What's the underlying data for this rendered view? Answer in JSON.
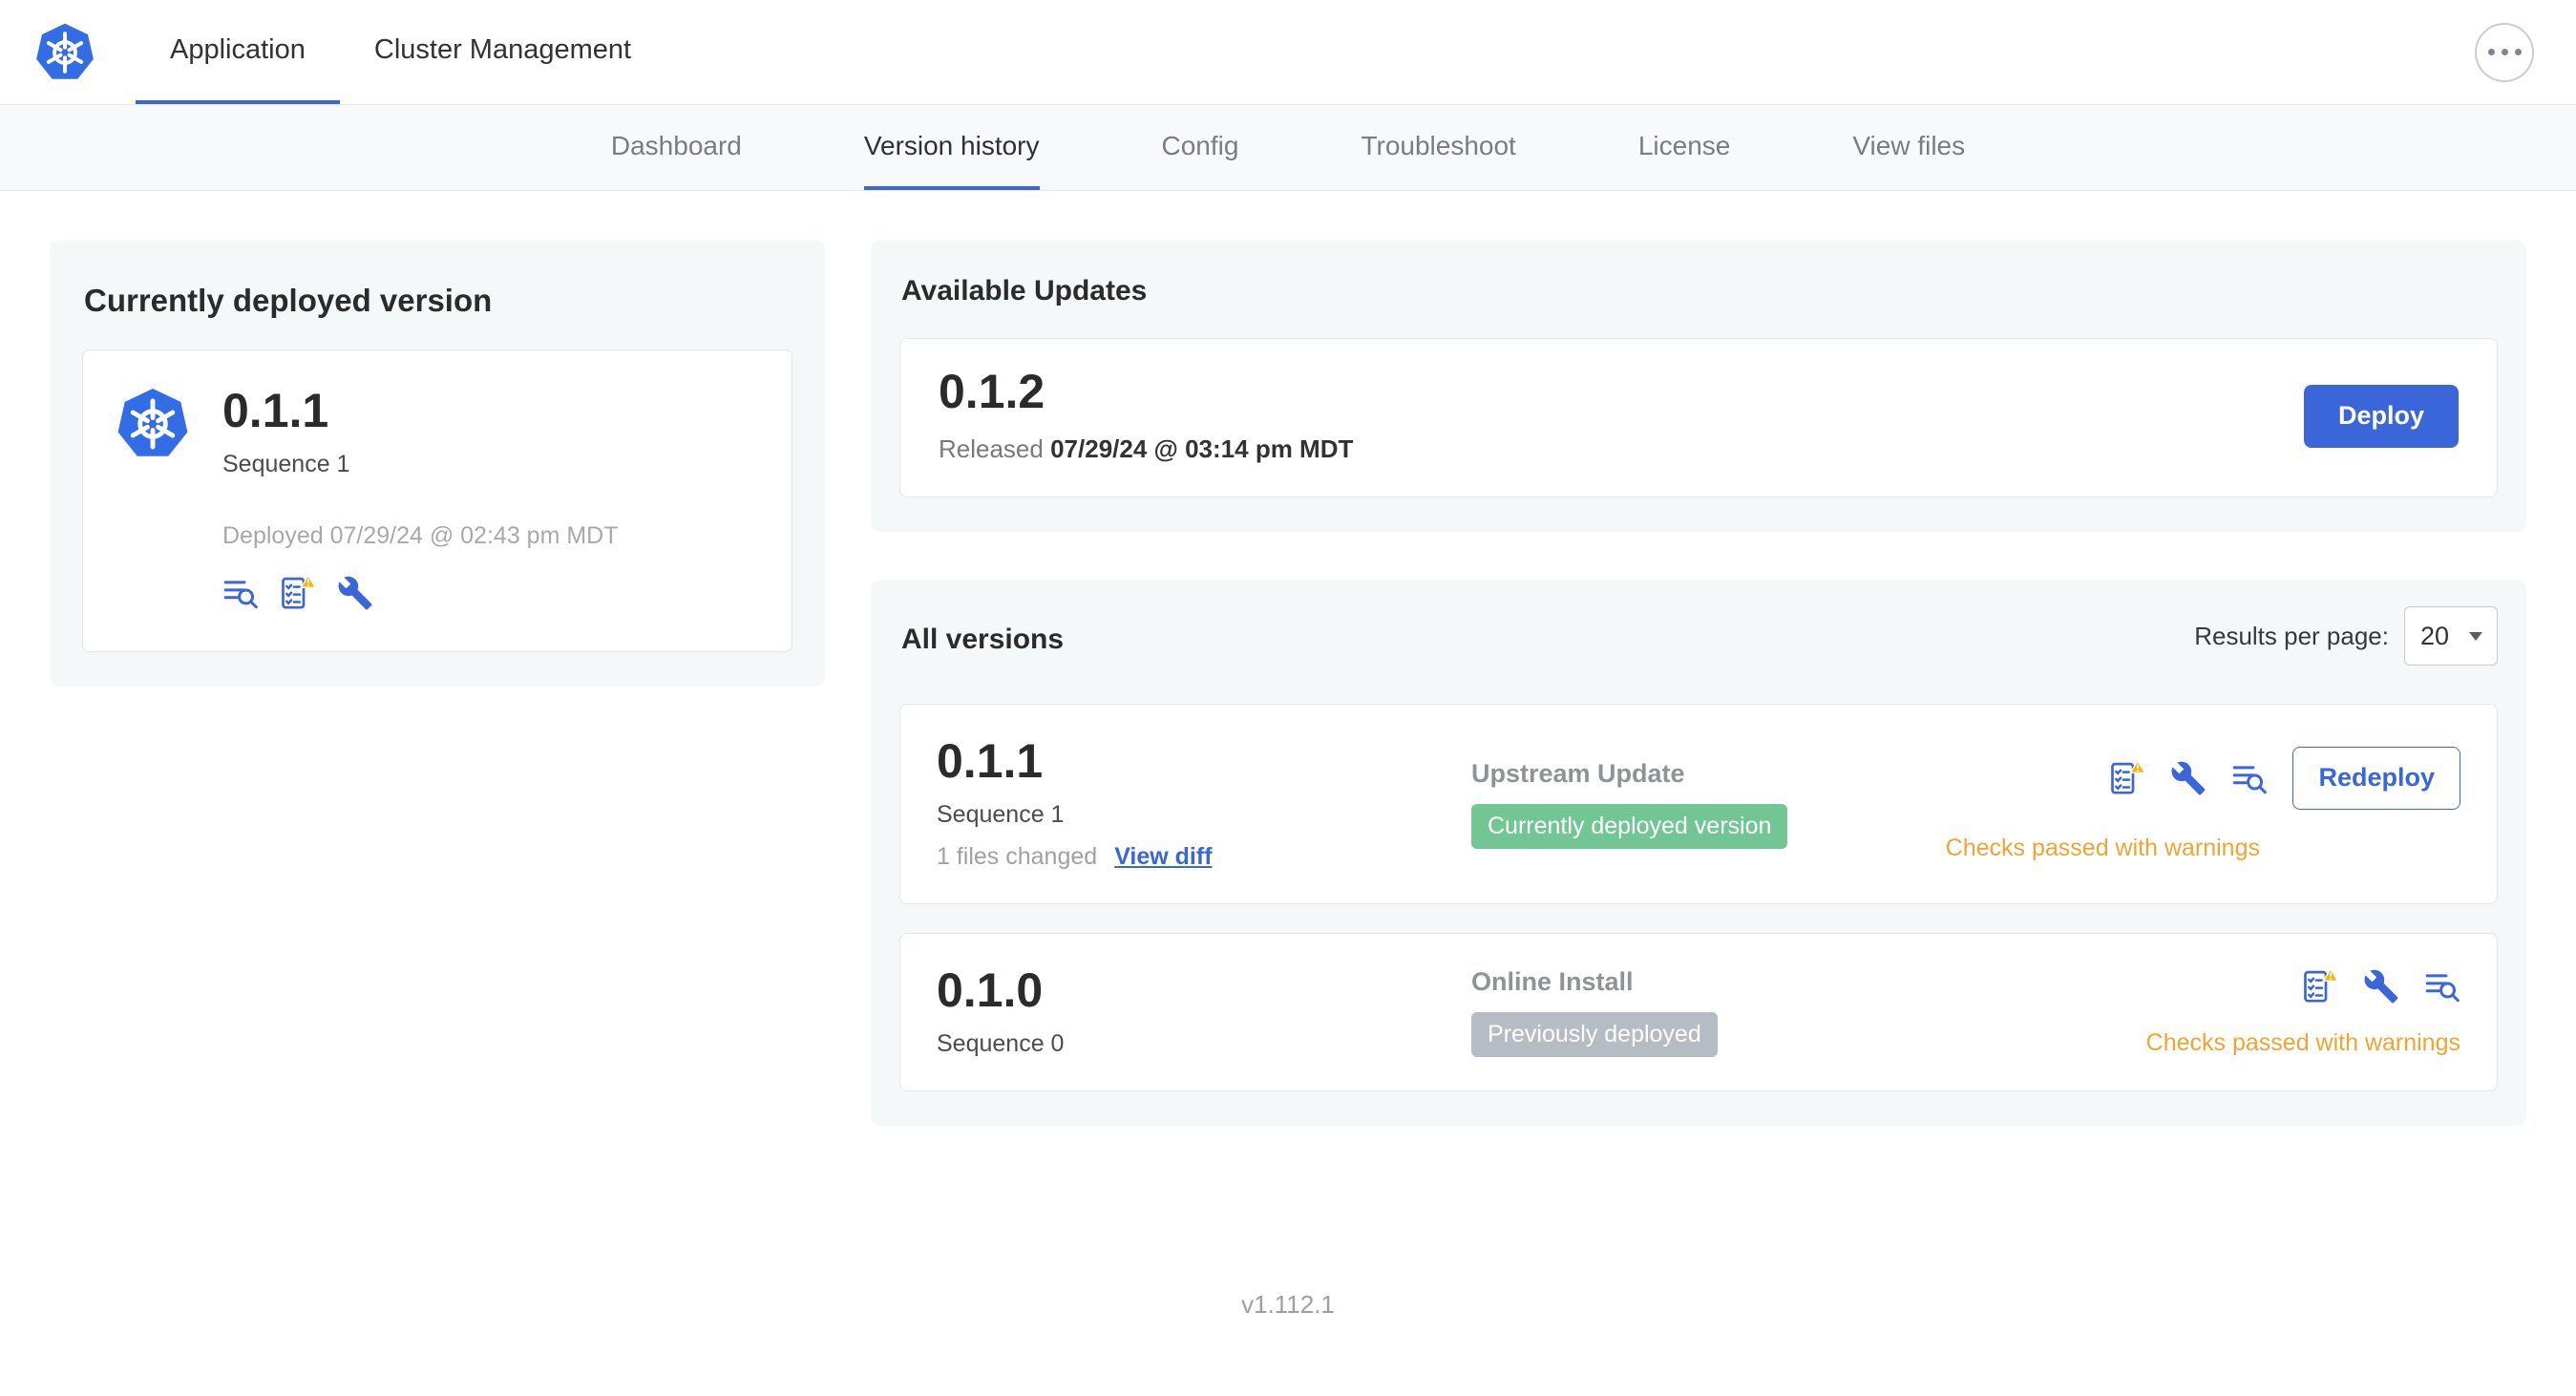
{
  "colors": {
    "accent": "#3a66d9",
    "k8s_blue": "#326de6",
    "badge_green": "#72c693",
    "badge_gray": "#b6bcc3",
    "warning_orange": "#f0a431",
    "card_bg": "#f5f8f9"
  },
  "header": {
    "tabs": [
      {
        "label": "Application"
      },
      {
        "label": "Cluster Management"
      }
    ]
  },
  "subnav": {
    "items": [
      {
        "label": "Dashboard"
      },
      {
        "label": "Version history"
      },
      {
        "label": "Config"
      },
      {
        "label": "Troubleshoot"
      },
      {
        "label": "License"
      },
      {
        "label": "View files"
      }
    ]
  },
  "current": {
    "title": "Currently deployed version",
    "version": "0.1.1",
    "sequence": "Sequence 1",
    "deployed": "Deployed 07/29/24 @ 02:43 pm MDT"
  },
  "available": {
    "title": "Available Updates",
    "version": "0.1.2",
    "released_prefix": "Released",
    "released_date": "07/29/24 @ 03:14 pm MDT",
    "deploy_label": "Deploy"
  },
  "all_versions": {
    "title": "All versions",
    "results_per_page_label": "Results per page:",
    "results_per_page_value": "20",
    "rows": [
      {
        "version": "0.1.1",
        "sequence": "Sequence 1",
        "files_changed": "1 files changed",
        "view_diff_label": "View diff",
        "source": "Upstream Update",
        "badge": "Currently deployed version",
        "status": "Checks passed with warnings",
        "action_label": "Redeploy"
      },
      {
        "version": "0.1.0",
        "sequence": "Sequence 0",
        "source": "Online Install",
        "badge": "Previously deployed",
        "status": "Checks passed with warnings"
      }
    ]
  },
  "footer": {
    "version": "v1.112.1"
  }
}
